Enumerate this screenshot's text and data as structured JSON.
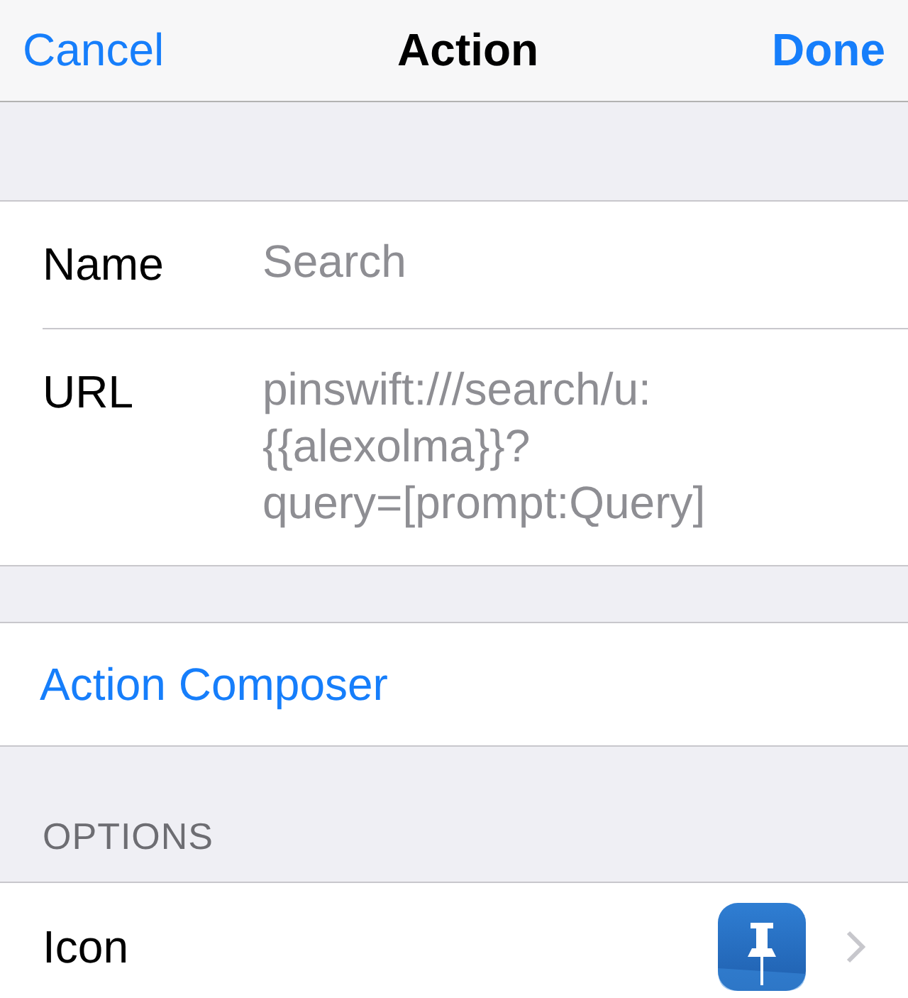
{
  "nav": {
    "cancel": "Cancel",
    "title": "Action",
    "done": "Done"
  },
  "fields": [
    {
      "label": "Name",
      "value_lines": [
        "Search"
      ]
    },
    {
      "label": "URL",
      "value_lines": [
        "pinswift:///search/u:",
        "{{alexolma}}?",
        "query=[prompt:Query]"
      ]
    }
  ],
  "composer": {
    "label": "Action Composer"
  },
  "options": {
    "header": "OPTIONS",
    "rows": [
      {
        "label": "Icon",
        "kind": "icon"
      }
    ]
  }
}
